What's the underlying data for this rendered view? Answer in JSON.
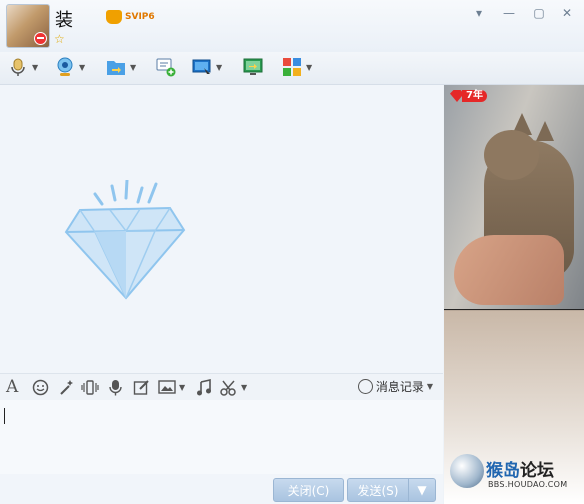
{
  "window": {
    "contact_name": "装",
    "vip_label": "SVIP6",
    "controls": [
      "chevron-down",
      "minimize",
      "maximize",
      "close"
    ]
  },
  "toolbar": {
    "tools": [
      {
        "name": "voice-call",
        "has_menu": true
      },
      {
        "name": "video-call",
        "has_menu": true
      },
      {
        "name": "send-file",
        "has_menu": true
      },
      {
        "name": "create-discussion",
        "has_menu": false
      },
      {
        "name": "remote-assistance",
        "has_menu": true
      },
      {
        "name": "share-screen",
        "has_menu": false
      },
      {
        "name": "apps",
        "has_menu": true
      }
    ]
  },
  "format_bar": {
    "history_label": "消息记录"
  },
  "footer": {
    "close_button": "关闭(C)",
    "send_button": "发送(S)"
  },
  "side_panel": {
    "year_badge": "7年",
    "logo_text": [
      "猴",
      "岛",
      "论",
      "坛"
    ],
    "logo_url": "BBS.HOUDAO.COM"
  },
  "colors": {
    "accent": "#3a8de0",
    "button": "#b3cbe6",
    "vip": "#e07800"
  }
}
